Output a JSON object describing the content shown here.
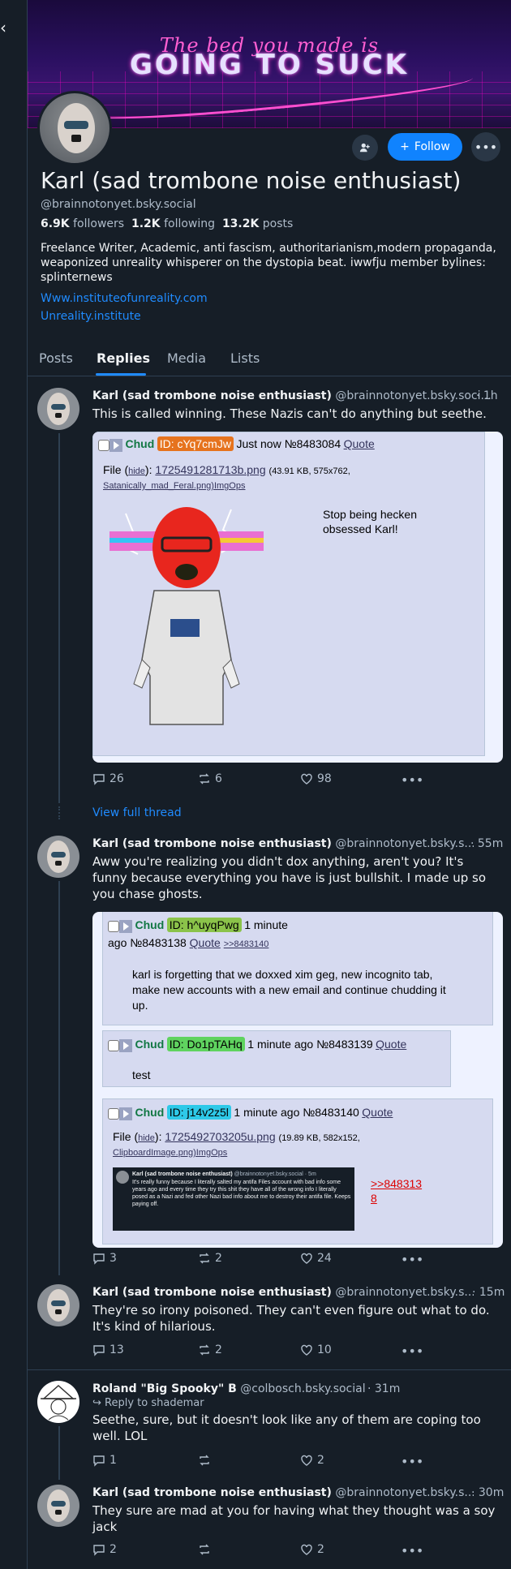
{
  "profile": {
    "banner_line1": "The bed you made is",
    "banner_line2": "GOING TO SUCK",
    "display_name": "Karl (sad trombone noise enthusiast)",
    "handle": "@brainnotonyet.bsky.social",
    "followers_count": "6.9K",
    "followers_label": "followers",
    "following_count": "1.2K",
    "following_label": "following",
    "posts_count": "13.2K",
    "posts_label": "posts",
    "bio": "Freelance Writer, Academic, anti fascism, authoritarianism,modern propaganda, weaponized unreality whisperer on the dystopia beat. iwwfju member bylines: splinternews",
    "link1": "Www.instituteofunreality.com",
    "link2": "Unreality.institute",
    "follow_label": "Follow"
  },
  "tabs": [
    "Posts",
    "Replies",
    "Media",
    "Lists"
  ],
  "view_full_thread": "View full thread",
  "posts": [
    {
      "author": "Karl (sad trombone noise enthusiast)",
      "handle": "@brainnotonyet.bsky.soci...",
      "time": "· 1h",
      "text": "This is called winning. These Nazis can't do anything but seethe.",
      "replies": "26",
      "reposts": "6",
      "likes": "98"
    },
    {
      "author": "Karl (sad trombone noise enthusiast)",
      "handle": "@brainnotonyet.bsky.s...",
      "time": "· 55m",
      "text": "Aww you're realizing you didn't dox anything, aren't you? It's funny because everything you have is just bullshit. I made up so you chase ghosts.",
      "replies": "3",
      "reposts": "2",
      "likes": "24"
    },
    {
      "author": "Karl (sad trombone noise enthusiast)",
      "handle": "@brainnotonyet.bsky.s...",
      "time": "· 15m",
      "text": "They're so irony poisoned. They can't even figure out what to do. It's kind of hilarious.",
      "replies": "13",
      "reposts": "2",
      "likes": "10"
    },
    {
      "author": "Roland \"Big Spooky\" B",
      "handle": "@colbosch.bsky.social",
      "time": "· 31m",
      "reply_to": "Reply to shademar",
      "text": "Seethe, sure, but it doesn't look like any of them are coping too well. LOL",
      "replies": "1",
      "reposts": "",
      "likes": "2"
    },
    {
      "author": "Karl (sad trombone noise enthusiast)",
      "handle": "@brainnotonyet.bsky.s...",
      "time": "· 30m",
      "text": "They sure are mad at you for having what they thought was a soy jack",
      "replies": "2",
      "reposts": "",
      "likes": "2"
    }
  ],
  "embed1": {
    "name": "Chud",
    "id": "ID: cYq7cmJw",
    "meta": "Just now №8483084",
    "quote": "Quote",
    "file_label": "File",
    "hide": "hide",
    "file_link": "1725491281713b.png",
    "file_info": "(43.91 KB, 575x762,",
    "file_orig": "Satanically_mad_Feral.png)ImgOps",
    "message": "Stop being hecken obsessed Karl!"
  },
  "embed2": {
    "p1_name": "Chud",
    "p1_id": "ID: h^uyqPwg",
    "p1_meta1": "1 minute",
    "p1_meta2": "ago №8483138",
    "p1_quote": "Quote",
    "p1_ref": ">>8483140",
    "p1_msg": "karl is forgetting that we doxxed xim geg, new incognito tab, make new accounts with a new email and continue chudding it up.",
    "p2_name": "Chud",
    "p2_id": "ID: Do1pTAHq",
    "p2_meta": "1 minute ago №8483139",
    "p2_quote": "Quote",
    "p2_msg": "test",
    "p3_name": "Chud",
    "p3_id": "ID: j14v2z5l",
    "p3_meta": "1 minute ago №8483140",
    "p3_quote": "Quote",
    "p3_file_label": "File",
    "p3_hide": "hide",
    "p3_file_link": "1725492703205u.png",
    "p3_file_info": "(19.89 KB, 582x152,",
    "p3_file_orig": "ClipboardImage.png)ImgOps",
    "p3_ref1": ">>848313",
    "p3_ref2": "8",
    "thumb_author": "Karl (sad trombone noise enthusiast)",
    "thumb_handle": "@brainnotonyet.bsky.social · 5m",
    "thumb_text": "It's really funny because I literally salted my antifa Files account with bad info some years ago and every time they try this shit they have all of the wrong info I literally posed as a Nazi and fed other Nazi bad info about me to destroy their antifa file. Keeps paying off."
  },
  "colors": {
    "accent": "#1083fe",
    "bg": "#161e27",
    "muted": "#aebbc9",
    "id1": "#e6731e",
    "id2": "#8bc34a",
    "id3": "#5fd35f",
    "id4": "#2ec9e8"
  }
}
